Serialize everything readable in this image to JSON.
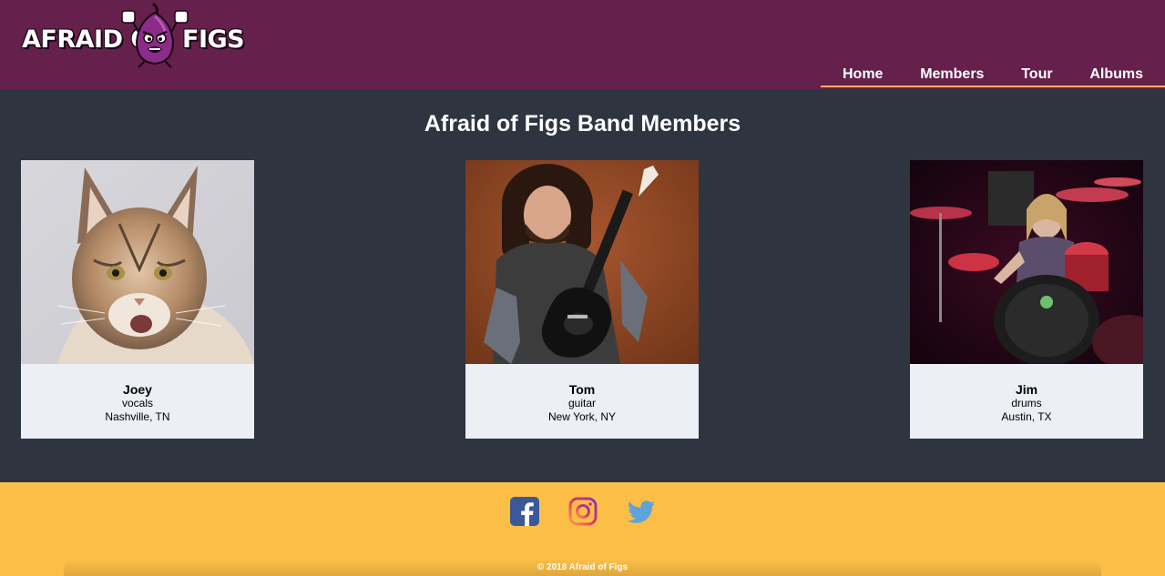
{
  "header": {
    "logo_left": "AFRAID OF",
    "logo_right": "FIGS",
    "nav": [
      {
        "label": "Home"
      },
      {
        "label": "Members"
      },
      {
        "label": "Tour"
      },
      {
        "label": "Albums"
      }
    ]
  },
  "main": {
    "title": "Afraid of Figs Band Members",
    "members": [
      {
        "name": "Joey",
        "role": "vocals",
        "city": "Nashville, TN"
      },
      {
        "name": "Tom",
        "role": "guitar",
        "city": "New York, NY"
      },
      {
        "name": "Jim",
        "role": "drums",
        "city": "Austin, TX"
      }
    ]
  },
  "footer": {
    "social": [
      "facebook-icon",
      "instagram-icon",
      "twitter-icon"
    ],
    "copyright": "© 2018 Afraid of Figs"
  },
  "colors": {
    "header_bg": "#65214b",
    "main_bg": "#2e3440",
    "footer_bg": "#fbbf47",
    "nav_underline": "#f6b25b",
    "card_bg": "#eceff4"
  }
}
